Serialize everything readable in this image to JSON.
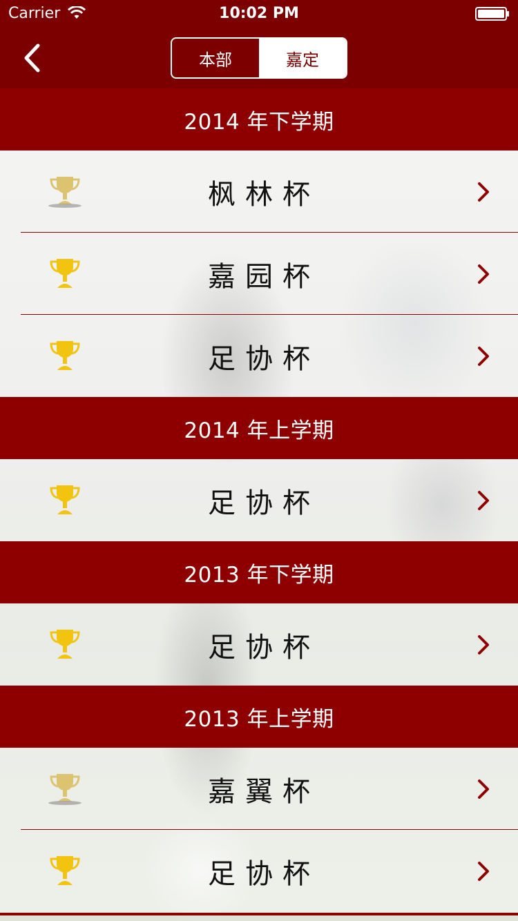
{
  "status_bar": {
    "carrier": "Carrier",
    "time": "10:02 PM"
  },
  "nav": {
    "back_icon": "chevron-left-icon",
    "segments": [
      "本部",
      "嘉定"
    ],
    "selected_segment": "嘉定"
  },
  "colors": {
    "primary": "#7c0000",
    "section": "#8e0000",
    "trophy_gold": "#f2c40f",
    "trophy_silver": "#d9c27a"
  },
  "sections": [
    {
      "title": "2014 年下学期",
      "items": [
        {
          "label": "枫林杯",
          "icon": "trophy-silver-icon"
        },
        {
          "label": "嘉园杯",
          "icon": "trophy-gold-icon"
        },
        {
          "label": "足协杯",
          "icon": "trophy-gold-icon"
        }
      ]
    },
    {
      "title": "2014 年上学期",
      "items": [
        {
          "label": "足协杯",
          "icon": "trophy-gold-icon"
        }
      ]
    },
    {
      "title": "2013 年下学期",
      "items": [
        {
          "label": "足协杯",
          "icon": "trophy-gold-icon"
        }
      ]
    },
    {
      "title": "2013 年上学期",
      "items": [
        {
          "label": "嘉翼杯",
          "icon": "trophy-silver-icon"
        },
        {
          "label": "足协杯",
          "icon": "trophy-gold-icon"
        }
      ]
    }
  ]
}
